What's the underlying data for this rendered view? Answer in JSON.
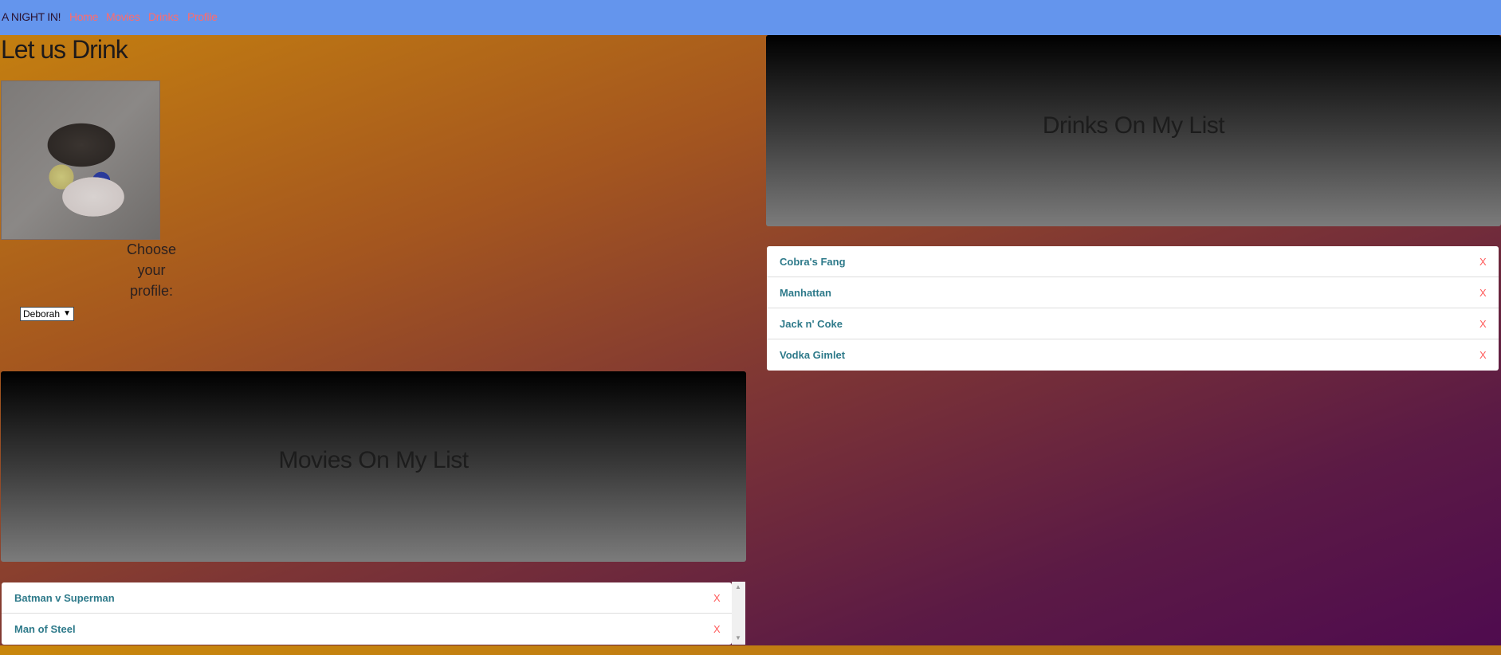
{
  "navbar": {
    "brand": "A NIGHT IN!",
    "links": [
      "Home",
      "Movies",
      "Drinks",
      "Profile"
    ]
  },
  "page": {
    "title": "Let us Drink",
    "choose_label_lines": [
      "Choose",
      "your",
      "profile:"
    ],
    "profile_select": {
      "selected": "Deborah"
    }
  },
  "drinks_panel": {
    "title": "Drinks On My List",
    "items": [
      {
        "label": "Cobra's Fang",
        "remove": "X"
      },
      {
        "label": "Manhattan",
        "remove": "X"
      },
      {
        "label": "Jack n' Coke",
        "remove": "X"
      },
      {
        "label": "Vodka Gimlet",
        "remove": "X"
      }
    ]
  },
  "movies_panel": {
    "title": "Movies On My List",
    "items": [
      {
        "label": "Batman v Superman",
        "remove": "X"
      },
      {
        "label": "Man of Steel",
        "remove": "X"
      }
    ]
  },
  "colors": {
    "navbar": "#6495ed",
    "link": "#ff6b6b",
    "item_text": "#2e7a8a",
    "remove": "#ff5c5c"
  }
}
